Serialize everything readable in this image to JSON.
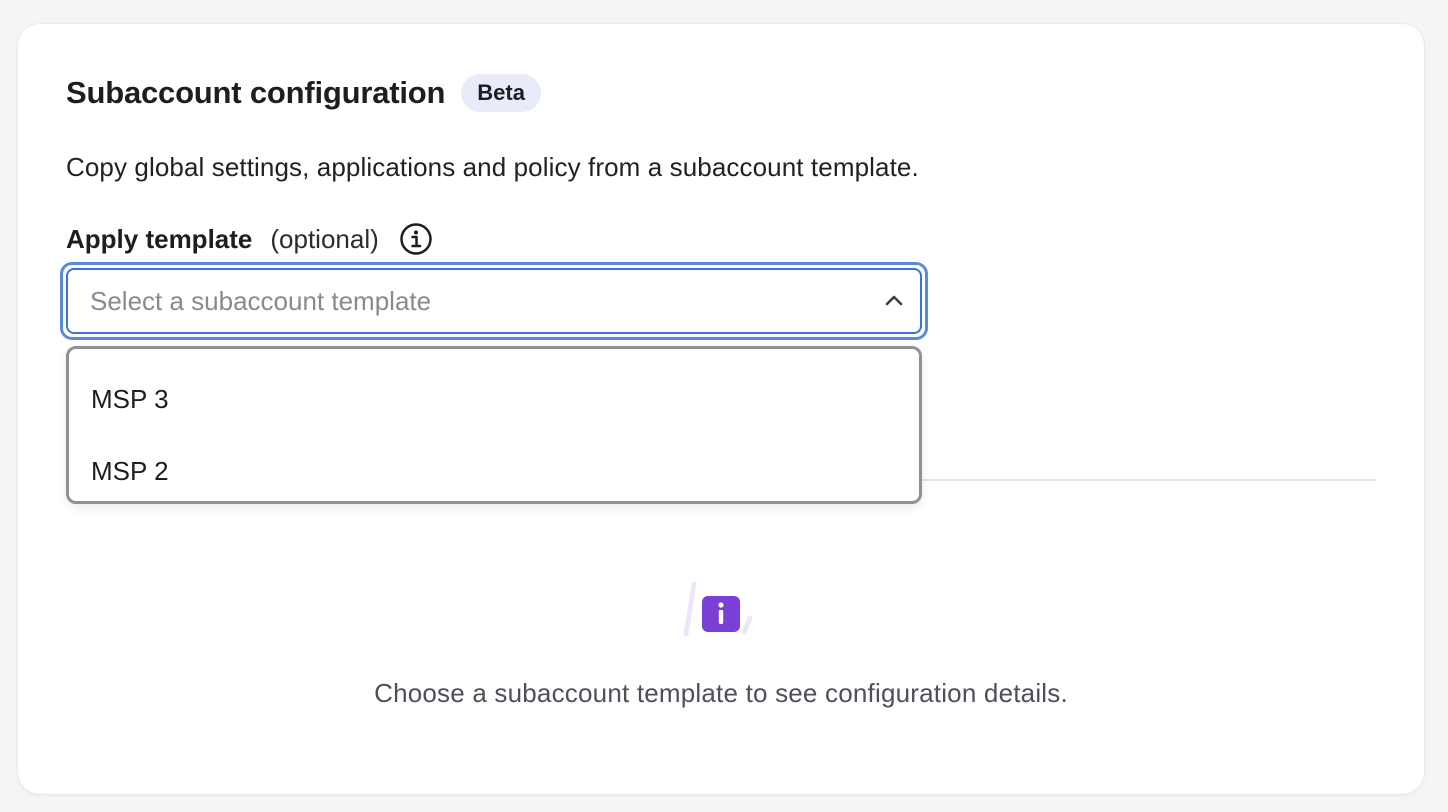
{
  "section": {
    "title": "Subaccount configuration",
    "badge": "Beta",
    "description": "Copy global settings, applications and policy from a subaccount template."
  },
  "field": {
    "label": "Apply template",
    "optional": "(optional)",
    "placeholder": "Select a subaccount template",
    "info_icon": "info-circle-icon",
    "chevron_icon": "chevron-up-icon",
    "options": [
      "MSP 3",
      "MSP 2"
    ]
  },
  "empty_state": {
    "icon": "info-badge-icon",
    "message": "Choose a subaccount template to see configuration details."
  },
  "colors": {
    "focus_ring": "#5b8ad8",
    "badge_bg": "#e9ebfb",
    "info_accent": "#7c3fd6"
  }
}
